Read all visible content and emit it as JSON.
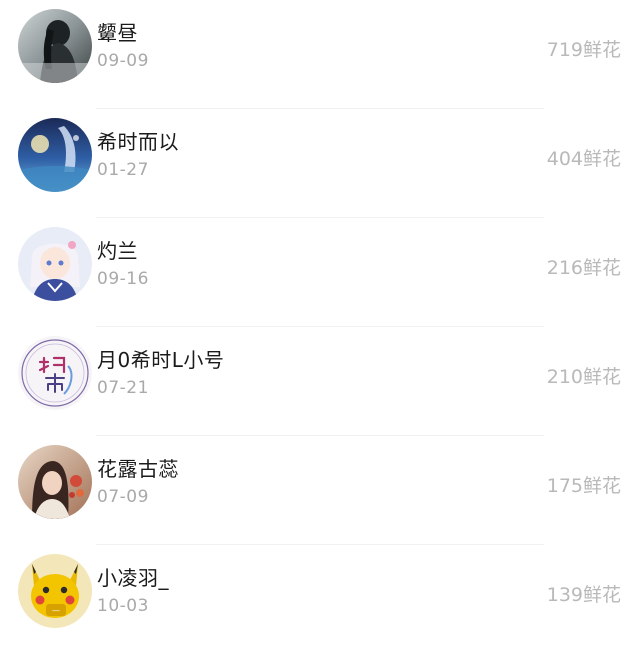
{
  "ranking": {
    "entries": [
      {
        "name": "颦昼",
        "date": "09-09",
        "flowers": "719鲜花",
        "avatar_icon": "avatar-dark-figure-icon"
      },
      {
        "name": "希时而以",
        "date": "01-27",
        "flowers": "404鲜花",
        "avatar_icon": "avatar-blue-fantasy-icon"
      },
      {
        "name": "灼兰",
        "date": "09-16",
        "flowers": "216鲜花",
        "avatar_icon": "avatar-anime-girl-icon"
      },
      {
        "name": "月0希时L小号",
        "date": "07-21",
        "flowers": "210鲜花",
        "avatar_icon": "avatar-calligraphy-logo-icon"
      },
      {
        "name": "花露古蕊",
        "date": "07-09",
        "flowers": "175鲜花",
        "avatar_icon": "avatar-girl-portrait-icon"
      },
      {
        "name": "小凌羽_",
        "date": "10-03",
        "flowers": "139鲜花",
        "avatar_icon": "avatar-yellow-pokemon-icon"
      }
    ]
  }
}
